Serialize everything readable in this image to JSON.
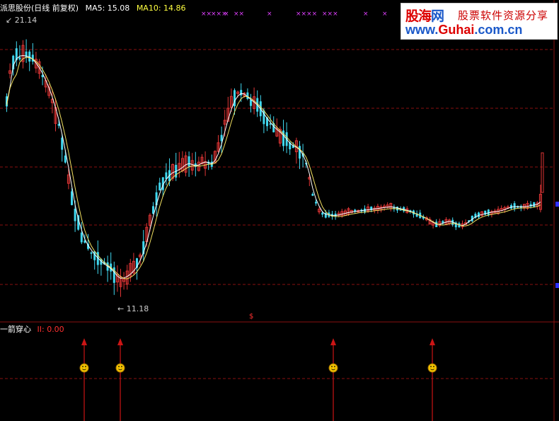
{
  "header": {
    "title": "派思股份(日线 前复权)",
    "ma5_label": "MA5: 15.08",
    "ma10_label": "MA10: 14.86"
  },
  "indicator": {
    "name": "一箭穿心",
    "value_label": "II: 0.00"
  },
  "price_labels": {
    "high": "21.14",
    "low": "11.18"
  },
  "marker_symbol": "$",
  "cross_marks": [
    "××",
    "×××",
    "×",
    "××",
    "×",
    "××××",
    "×××",
    "×",
    "×"
  ],
  "logo": {
    "brand": "股海网",
    "brand_a": "股海",
    "brand_b": "网",
    "tagline": "股票软件资源分享",
    "url": "www.Guhai.com.cn",
    "url_a": "www.",
    "url_b": "Guhai",
    "url_c": ".com.cn"
  },
  "colors": {
    "up": "#e03535",
    "down": "#40d8f0",
    "ma5": "#ffffff",
    "ma10": "#f2e060",
    "grid": "#8a1010",
    "signal": "#cc1515",
    "header_white": "#ffffff",
    "header_yellow": "#ffff40",
    "indicator_value": "#ff3030",
    "cross": "#e040ff"
  },
  "signal_icon": "smiley-face-icon"
}
